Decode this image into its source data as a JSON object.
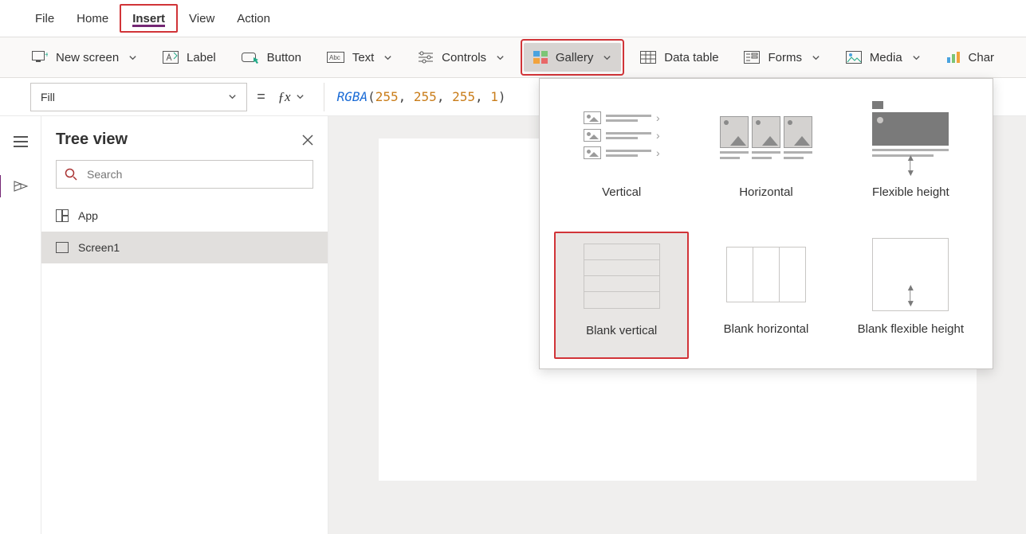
{
  "menu": {
    "file": "File",
    "home": "Home",
    "insert": "Insert",
    "view": "View",
    "action": "Action"
  },
  "ribbon": {
    "newscreen": "New screen",
    "label": "Label",
    "button": "Button",
    "text": "Text",
    "controls": "Controls",
    "gallery": "Gallery",
    "datatable": "Data table",
    "forms": "Forms",
    "media": "Media",
    "charts": "Char"
  },
  "formula": {
    "property": "Fill",
    "fn": "RGBA",
    "a": "255",
    "b": "255",
    "c": "255",
    "d": "1"
  },
  "tree": {
    "title": "Tree view",
    "search_placeholder": "Search",
    "app": "App",
    "screen": "Screen1"
  },
  "gallery": {
    "vertical": "Vertical",
    "horizontal": "Horizontal",
    "flexh": "Flexible height",
    "blankv": "Blank vertical",
    "blankh": "Blank horizontal",
    "blankfh": "Blank flexible height"
  }
}
